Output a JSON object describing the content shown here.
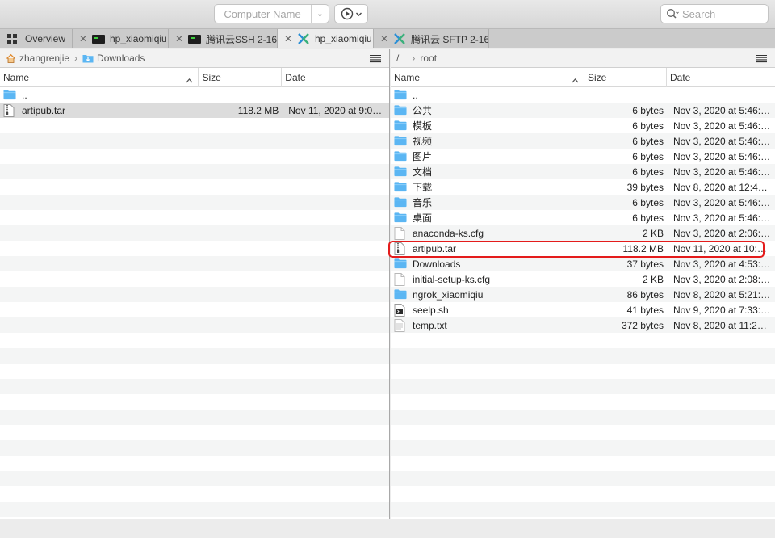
{
  "toolbar": {
    "computer_name_placeholder": "Computer Name",
    "search_placeholder": "Search"
  },
  "tabs": [
    {
      "label": "Overview",
      "icon": "grid-icon",
      "closable": false,
      "active": false
    },
    {
      "label": "hp_xiaomiqiu",
      "icon": "terminal-icon",
      "closable": true,
      "active": false
    },
    {
      "label": "腾讯云SSH 2-16",
      "icon": "terminal-icon",
      "closable": true,
      "active": false
    },
    {
      "label": "hp_xiaomiqiu",
      "icon": "sftp-icon",
      "closable": true,
      "active": true
    },
    {
      "label": "腾讯云 SFTP 2-16",
      "icon": "sftp-icon",
      "closable": true,
      "active": false
    }
  ],
  "left": {
    "path": [
      "zhangrenjie",
      "Downloads"
    ],
    "columns": {
      "name": "Name",
      "size": "Size",
      "date": "Date"
    },
    "rows": [
      {
        "name": "..",
        "size": "",
        "date": "",
        "icon": "folder-icon"
      },
      {
        "name": "artipub.tar",
        "size": "118.2 MB",
        "date": "Nov 11, 2020 at 9:09:...",
        "icon": "archive-icon",
        "selected": true
      }
    ]
  },
  "right": {
    "path": [
      "/",
      "root"
    ],
    "columns": {
      "name": "Name",
      "size": "Size",
      "date": "Date"
    },
    "rows": [
      {
        "name": "..",
        "size": "",
        "date": "",
        "icon": "folder-icon"
      },
      {
        "name": "公共",
        "size": "6 bytes",
        "date": "Nov 3, 2020 at 5:46:3...",
        "icon": "folder-icon"
      },
      {
        "name": "模板",
        "size": "6 bytes",
        "date": "Nov 3, 2020 at 5:46:3...",
        "icon": "folder-icon"
      },
      {
        "name": "视频",
        "size": "6 bytes",
        "date": "Nov 3, 2020 at 5:46:3...",
        "icon": "folder-icon"
      },
      {
        "name": "图片",
        "size": "6 bytes",
        "date": "Nov 3, 2020 at 5:46:3...",
        "icon": "folder-icon"
      },
      {
        "name": "文档",
        "size": "6 bytes",
        "date": "Nov 3, 2020 at 5:46:3...",
        "icon": "folder-icon"
      },
      {
        "name": "下载",
        "size": "39 bytes",
        "date": "Nov 8, 2020 at 12:47:...",
        "icon": "folder-icon"
      },
      {
        "name": "音乐",
        "size": "6 bytes",
        "date": "Nov 3, 2020 at 5:46:3...",
        "icon": "folder-icon"
      },
      {
        "name": "桌面",
        "size": "6 bytes",
        "date": "Nov 3, 2020 at 5:46:3...",
        "icon": "folder-icon"
      },
      {
        "name": "anaconda-ks.cfg",
        "size": "2 KB",
        "date": "Nov 3, 2020 at 2:06:4...",
        "icon": "file-icon"
      },
      {
        "name": "artipub.tar",
        "size": "118.2 MB",
        "date": "Nov 11, 2020 at 10:04...",
        "icon": "archive-icon",
        "highlighted": true
      },
      {
        "name": "Downloads",
        "size": "37 bytes",
        "date": "Nov 3, 2020 at 4:53:3...",
        "icon": "folder-icon"
      },
      {
        "name": "initial-setup-ks.cfg",
        "size": "2 KB",
        "date": "Nov 3, 2020 at 2:08:0...",
        "icon": "file-icon"
      },
      {
        "name": "ngrok_xiaomiqiu",
        "size": "86 bytes",
        "date": "Nov 8, 2020 at 5:21:4...",
        "icon": "folder-icon"
      },
      {
        "name": "seelp.sh",
        "size": "41 bytes",
        "date": "Nov 9, 2020 at 7:33:5...",
        "icon": "script-icon"
      },
      {
        "name": "temp.txt",
        "size": "372 bytes",
        "date": "Nov 8, 2020 at 11:28:...",
        "icon": "text-file-icon"
      }
    ]
  },
  "colors": {
    "highlight": "#e41c1c",
    "folder": "#5bb6f3",
    "selected_row": "#dcdcdc"
  }
}
